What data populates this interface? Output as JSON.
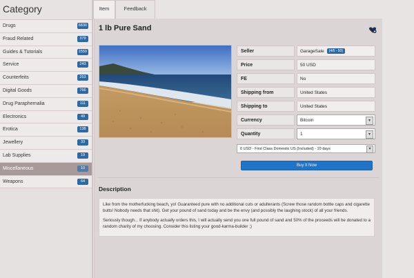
{
  "sidebar": {
    "title": "Category",
    "items": [
      {
        "label": "Drugs",
        "count": "6830"
      },
      {
        "label": "Fraud Related",
        "count": "379"
      },
      {
        "label": "Guides & Tutorials",
        "count": "1559"
      },
      {
        "label": "Service",
        "count": "243"
      },
      {
        "label": "Counterfeits",
        "count": "253"
      },
      {
        "label": "Digital Goods",
        "count": "766"
      },
      {
        "label": "Drug Paraphernalia",
        "count": "111"
      },
      {
        "label": "Electronics",
        "count": "49"
      },
      {
        "label": "Erotica",
        "count": "138"
      },
      {
        "label": "Jewellery",
        "count": "33"
      },
      {
        "label": "Lab Supplies",
        "count": "19"
      },
      {
        "label": "Miscellaneous",
        "count": "10"
      },
      {
        "label": "Weapons",
        "count": "64"
      }
    ],
    "active_index": 11
  },
  "tabs": {
    "item": "Item",
    "feedback": "Feedback"
  },
  "listing": {
    "title": "1 lb Pure Sand",
    "seller_label": "Seller",
    "seller_value": "GarageSale",
    "seller_badge": "(4/6 - 93)",
    "price_label": "Price",
    "price_value": "50 USD",
    "fe_label": "FE",
    "fe_value": "No",
    "shipping_from_label": "Shipping from",
    "shipping_from_value": "United States",
    "shipping_to_label": "Shipping to",
    "shipping_to_value": "United States",
    "currency_label": "Currency",
    "currency_value": "Bitcoin",
    "quantity_label": "Quantity",
    "quantity_value": "1",
    "shipping_option": "0 USD - First Class Domestic US (Included) - 10 days",
    "buy_label": "Buy It Now"
  },
  "description": {
    "title": "Description",
    "p1": "Like from the motherfucking beach, yo! Guaranteed pure with no additional cuts or adulterants (Screw those random bottle caps and cigarette butts! Nobody needs that shit). Get your pound of sand today and be the envy (and possibly the laughing stock) of all your friends.",
    "p2": "Seriously though... If anybody actually orders this, I will actually send you one full pound of sand and 50% of the proceeds will be donated to a random charity of my choosing. Consider this listing your good-karma-builder ;)"
  },
  "colors": {
    "accent": "#2b6aa5",
    "buy_button": "#1f74c8",
    "active_category": "#a99a9a"
  },
  "icons": {
    "favorite": "heart-plus-icon",
    "select": "chevron-down-icon"
  }
}
